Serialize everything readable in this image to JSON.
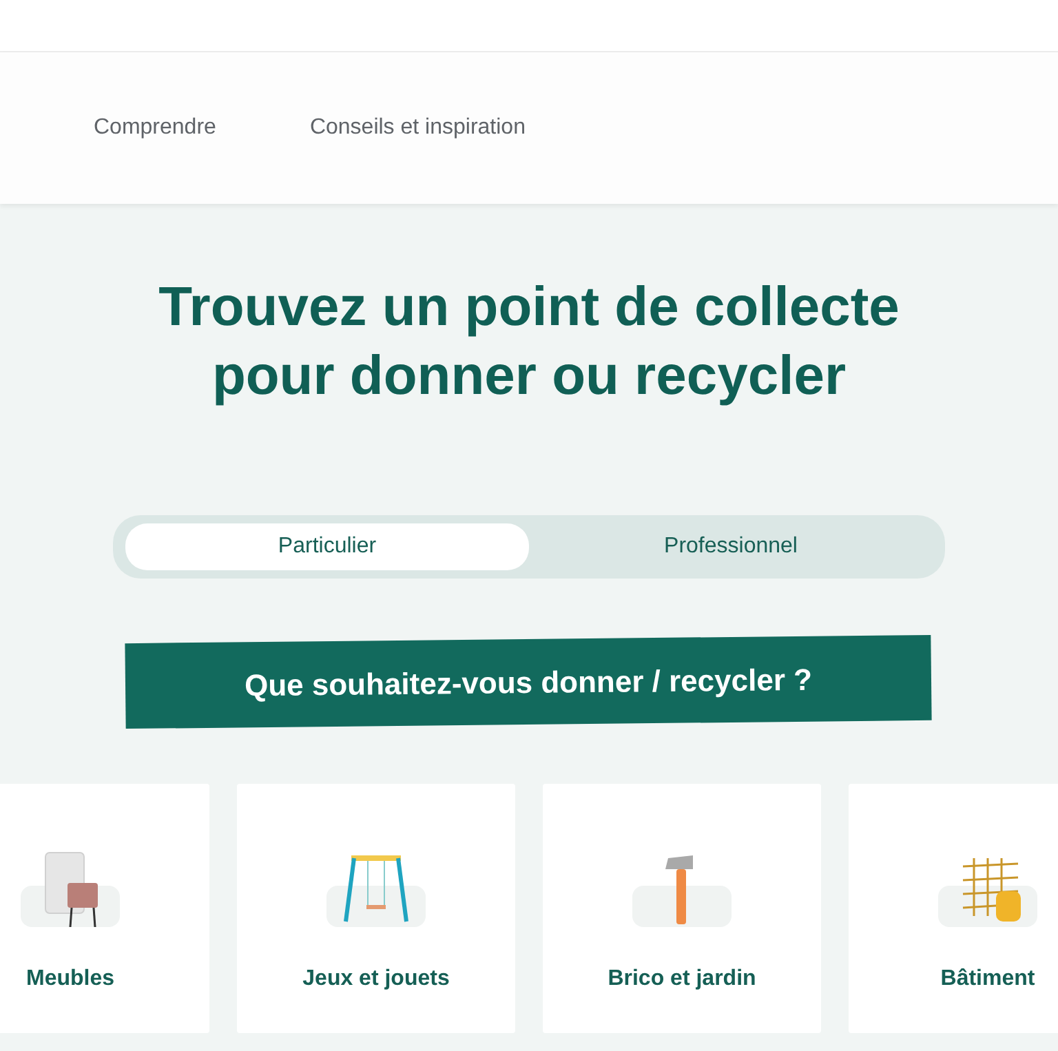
{
  "nav": {
    "items": [
      {
        "label": "Comprendre"
      },
      {
        "label": "Conseils et inspiration"
      }
    ]
  },
  "hero": {
    "title": "Trouvez un point de collecte pour donner ou recycler"
  },
  "audience_toggle": [
    {
      "label": "Particulier",
      "selected": true
    },
    {
      "label": "Professionnel",
      "selected": false
    }
  ],
  "question": "Que souhaitez-vous donner / recycler ?",
  "categories": [
    {
      "label": "Meubles"
    },
    {
      "label": "Jeux et jouets"
    },
    {
      "label": "Brico et jardin"
    },
    {
      "label": "Bâtiment"
    }
  ]
}
